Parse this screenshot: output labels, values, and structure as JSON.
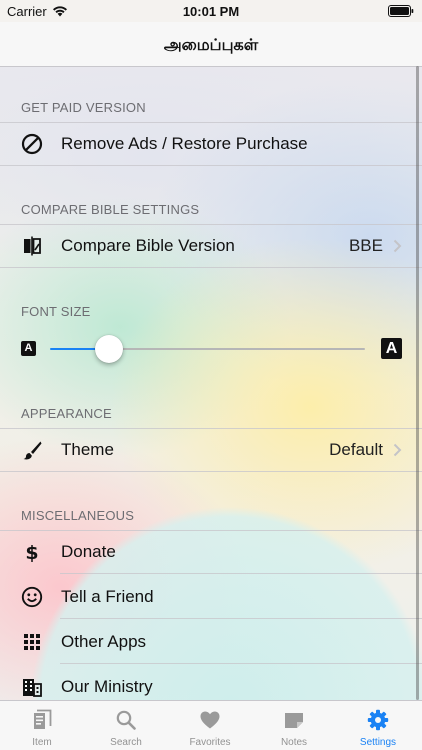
{
  "status_bar": {
    "carrier": "Carrier",
    "time": "10:01 PM"
  },
  "nav": {
    "title": "அமைப்புகள்"
  },
  "sections": {
    "paid": {
      "header": "GET PAID VERSION",
      "row": {
        "label": "Remove Ads / Restore Purchase",
        "icon": "block-icon"
      }
    },
    "compare": {
      "header": "COMPARE BIBLE SETTINGS",
      "row": {
        "label": "Compare Bible Version",
        "value": "BBE",
        "icon": "compare-icon"
      }
    },
    "font": {
      "header": "FONT SIZE",
      "small_glyph": "A",
      "large_glyph": "A",
      "slider_value_fraction": 0.19
    },
    "appearance": {
      "header": "APPEARANCE",
      "row": {
        "label": "Theme",
        "value": "Default",
        "icon": "brush-icon"
      }
    },
    "misc": {
      "header": "MISCELLANEOUS",
      "rows": [
        {
          "label": "Donate",
          "icon": "dollar-icon"
        },
        {
          "label": "Tell a Friend",
          "icon": "smiley-icon"
        },
        {
          "label": "Other Apps",
          "icon": "grid-icon"
        },
        {
          "label": "Our Ministry",
          "icon": "building-icon"
        }
      ]
    }
  },
  "tabs": [
    {
      "label": "Item",
      "icon": "book-icon",
      "active": false
    },
    {
      "label": "Search",
      "icon": "search-icon",
      "active": false
    },
    {
      "label": "Favorites",
      "icon": "heart-icon",
      "active": false
    },
    {
      "label": "Notes",
      "icon": "note-icon",
      "active": false
    },
    {
      "label": "Settings",
      "icon": "gear-icon",
      "active": true
    }
  ],
  "colors": {
    "accent": "#1a82f4",
    "tab_inactive": "#929292",
    "section_header": "#6d6d72"
  }
}
